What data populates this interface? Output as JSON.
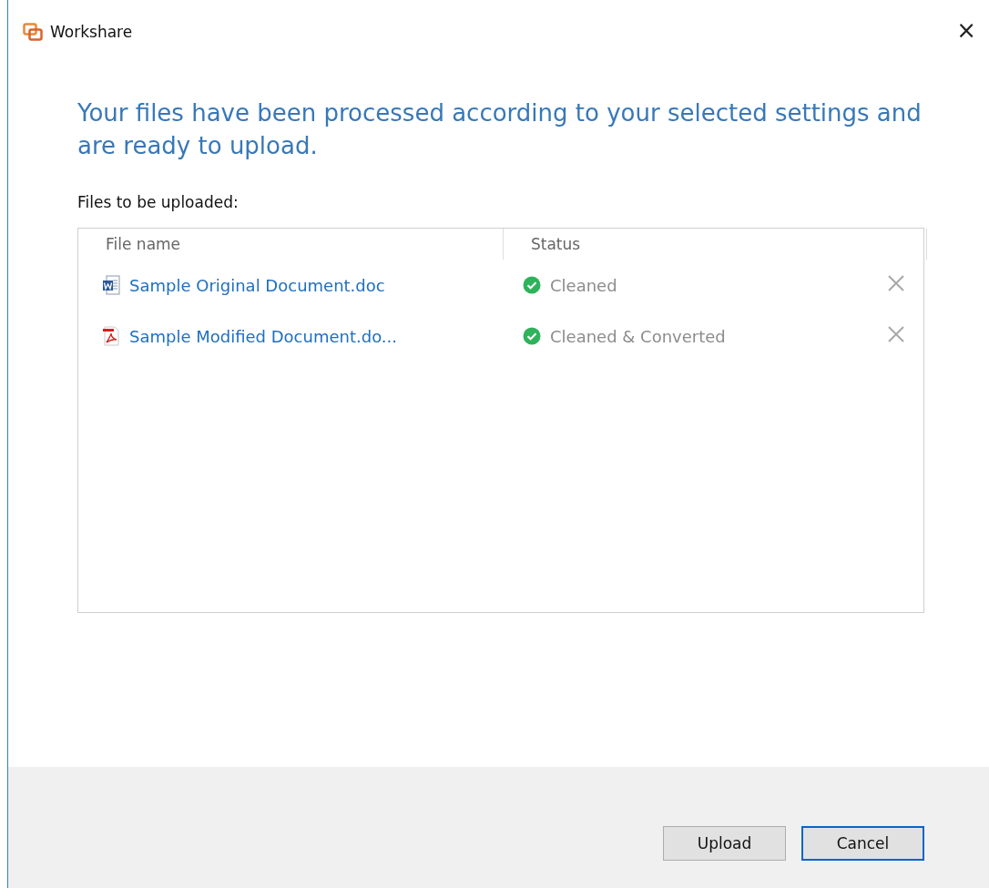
{
  "window": {
    "title": "Workshare",
    "close": "×"
  },
  "heading": "Your files have been processed according to your selected settings and are ready to upload.",
  "list_label": "Files to be uploaded:",
  "table": {
    "columns": [
      "File name",
      "Status"
    ],
    "rows": [
      {
        "kind": "word",
        "name": "Sample Original Document.doc",
        "status": "Cleaned"
      },
      {
        "kind": "pdf",
        "name": "Sample Modified Document.do...",
        "status": "Cleaned & Converted"
      }
    ]
  },
  "buttons": [
    {
      "label": "Upload",
      "focused": false
    },
    {
      "label": "Cancel",
      "focused": true
    }
  ]
}
